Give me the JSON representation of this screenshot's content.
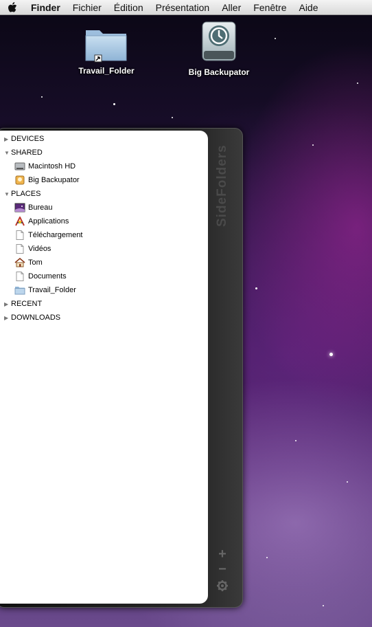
{
  "menubar": {
    "apple_icon": "apple-icon",
    "items": [
      "Finder",
      "Fichier",
      "Édition",
      "Présentation",
      "Aller",
      "Fenêtre",
      "Aide"
    ]
  },
  "desktop": {
    "icons": [
      {
        "label": "Travail_Folder",
        "icon": "folder-alias-icon"
      },
      {
        "label": "Big Backupator",
        "icon": "time-machine-drive-icon"
      }
    ]
  },
  "sidefolders": {
    "title": "SideFolders",
    "sections": [
      {
        "label": "DEVICES",
        "expanded": false,
        "items": []
      },
      {
        "label": "SHARED",
        "expanded": true,
        "items": [
          {
            "label": "Macintosh HD",
            "icon": "hard-drive-icon"
          },
          {
            "label": "Big Backupator",
            "icon": "external-drive-icon"
          }
        ]
      },
      {
        "label": "PLACES",
        "expanded": true,
        "items": [
          {
            "label": "Bureau",
            "icon": "desktop-icon"
          },
          {
            "label": "Applications",
            "icon": "applications-icon"
          },
          {
            "label": "Téléchargement",
            "icon": "document-icon"
          },
          {
            "label": "Vidéos",
            "icon": "document-icon"
          },
          {
            "label": "Tom",
            "icon": "home-icon"
          },
          {
            "label": "Documents",
            "icon": "document-icon"
          },
          {
            "label": "Travail_Folder",
            "icon": "folder-icon"
          }
        ]
      },
      {
        "label": "RECENT",
        "expanded": false,
        "items": []
      },
      {
        "label": "DOWNLOADS",
        "expanded": false,
        "items": []
      }
    ],
    "controls": {
      "add": "+",
      "remove": "−",
      "settings_icon": "gear-icon"
    }
  }
}
